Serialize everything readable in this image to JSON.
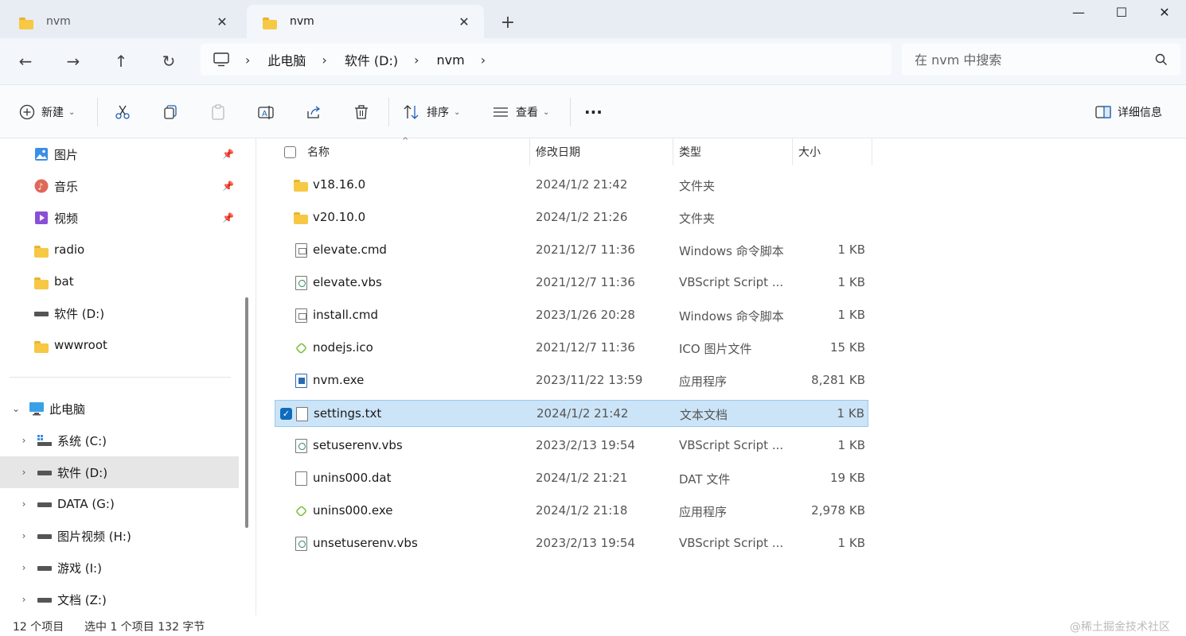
{
  "tabs": [
    {
      "label": "nvm",
      "active": false
    },
    {
      "label": "nvm",
      "active": true
    }
  ],
  "breadcrumb": [
    "此电脑",
    "软件 (D:)",
    "nvm"
  ],
  "search": {
    "placeholder": "在 nvm 中搜索"
  },
  "toolbar": {
    "new_label": "新建",
    "sort_label": "排序",
    "view_label": "查看",
    "more_label": "···",
    "details_label": "详细信息"
  },
  "sidebar": {
    "quick": [
      {
        "label": "图片",
        "icon": "pictures-icon",
        "pinned": true
      },
      {
        "label": "音乐",
        "icon": "music-icon",
        "pinned": true
      },
      {
        "label": "视频",
        "icon": "video-icon",
        "pinned": true
      },
      {
        "label": "radio",
        "icon": "folder-icon",
        "pinned": false
      },
      {
        "label": "bat",
        "icon": "folder-icon",
        "pinned": false
      },
      {
        "label": "软件 (D:)",
        "icon": "drive-icon",
        "pinned": false
      },
      {
        "label": "wwwroot",
        "icon": "folder-icon",
        "pinned": false
      }
    ],
    "this_pc_label": "此电脑",
    "drives": [
      {
        "label": "系统 (C:)",
        "selected": false
      },
      {
        "label": "软件 (D:)",
        "selected": true
      },
      {
        "label": "DATA (G:)",
        "selected": false
      },
      {
        "label": "图片视频 (H:)",
        "selected": false
      },
      {
        "label": "游戏 (I:)",
        "selected": false
      },
      {
        "label": "文档 (Z:)",
        "selected": false
      }
    ]
  },
  "columns": {
    "name": "名称",
    "date": "修改日期",
    "type": "类型",
    "size": "大小"
  },
  "files": [
    {
      "name": "v18.16.0",
      "date": "2024/1/2 21:42",
      "type": "文件夹",
      "size": "",
      "icon": "folder-icon",
      "selected": false
    },
    {
      "name": "v20.10.0",
      "date": "2024/1/2 21:26",
      "type": "文件夹",
      "size": "",
      "icon": "folder-icon",
      "selected": false
    },
    {
      "name": "elevate.cmd",
      "date": "2021/12/7 11:36",
      "type": "Windows 命令脚本",
      "size": "1 KB",
      "icon": "cmd-file-icon",
      "selected": false
    },
    {
      "name": "elevate.vbs",
      "date": "2021/12/7 11:36",
      "type": "VBScript Script ...",
      "size": "1 KB",
      "icon": "script-file-icon",
      "selected": false
    },
    {
      "name": "install.cmd",
      "date": "2023/1/26 20:28",
      "type": "Windows 命令脚本",
      "size": "1 KB",
      "icon": "cmd-file-icon",
      "selected": false
    },
    {
      "name": "nodejs.ico",
      "date": "2021/12/7 11:36",
      "type": "ICO 图片文件",
      "size": "15 KB",
      "icon": "nodejs-icon",
      "selected": false
    },
    {
      "name": "nvm.exe",
      "date": "2023/11/22 13:59",
      "type": "应用程序",
      "size": "8,281 KB",
      "icon": "exe-file-icon",
      "selected": false
    },
    {
      "name": "settings.txt",
      "date": "2024/1/2 21:42",
      "type": "文本文档",
      "size": "1 KB",
      "icon": "text-file-icon",
      "selected": true
    },
    {
      "name": "setuserenv.vbs",
      "date": "2023/2/13 19:54",
      "type": "VBScript Script ...",
      "size": "1 KB",
      "icon": "script-file-icon",
      "selected": false
    },
    {
      "name": "unins000.dat",
      "date": "2024/1/2 21:21",
      "type": "DAT 文件",
      "size": "19 KB",
      "icon": "blank-file-icon",
      "selected": false
    },
    {
      "name": "unins000.exe",
      "date": "2024/1/2 21:18",
      "type": "应用程序",
      "size": "2,978 KB",
      "icon": "nodejs-icon",
      "selected": false
    },
    {
      "name": "unsetuserenv.vbs",
      "date": "2023/2/13 19:54",
      "type": "VBScript Script ...",
      "size": "1 KB",
      "icon": "script-file-icon",
      "selected": false
    }
  ],
  "status": {
    "count": "12 个项目",
    "selection": "选中 1 个项目  132 字节",
    "watermark": "@稀土掘金技术社区"
  }
}
